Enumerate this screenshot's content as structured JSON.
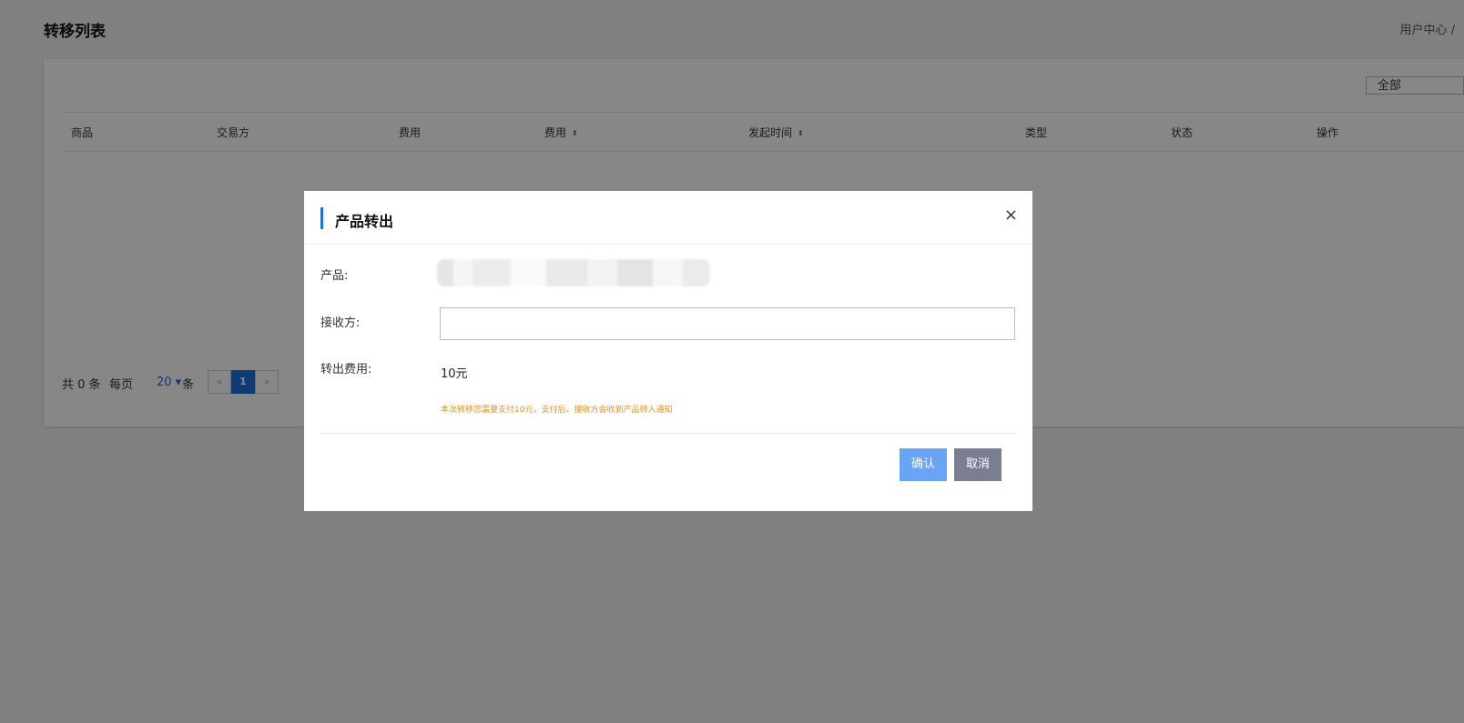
{
  "page": {
    "title": "转移列表",
    "breadcrumb": "用户中心 /",
    "filter_value": "全部"
  },
  "table": {
    "headers": [
      "商品",
      "交易方",
      "费用",
      "费用",
      "发起时间",
      "类型",
      "状态",
      "操作"
    ],
    "sort_icon": "⬍"
  },
  "pager": {
    "total": "共 0 条",
    "per_page_label": "每页",
    "per_page_value": "20 ▾",
    "unit": "条",
    "prev": "«",
    "current": "1",
    "next": "»"
  },
  "modal": {
    "title": "产品转出",
    "close": "×",
    "product_label": "产品:",
    "receiver_label": "接收方:",
    "receiver_value": "",
    "fee_label": "转出费用:",
    "fee_value": "10元",
    "notice": "本次转移您需要支付10元，支付后，接收方会收到产品转入通知",
    "confirm": "确认",
    "cancel": "取消"
  },
  "colors": {
    "accent": "#1e6fd9",
    "confirm": "#6aa4f5",
    "cancel": "#797e90",
    "notice": "#e89020",
    "annotation": "#e03a3a"
  }
}
